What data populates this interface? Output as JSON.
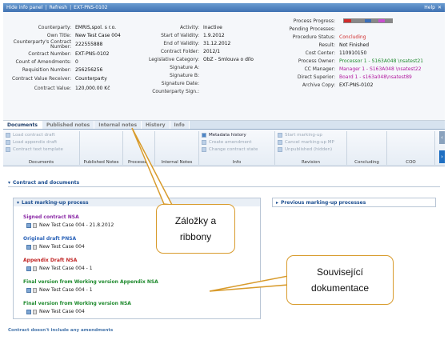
{
  "titlebar": {
    "hide": "Hide info panel",
    "refresh": "Refresh",
    "id": "EXT-PNS-0102",
    "help": "Help"
  },
  "col1": [
    {
      "label": "Counterparty:",
      "value": "EMRIS,spol. s r.o."
    },
    {
      "label": "Own Title:",
      "value": "New Test Case 004"
    },
    {
      "label": "Counterparty's Contract Number:",
      "value": "222555888"
    },
    {
      "label": "Contract Number:",
      "value": "EXT-PNS-0102"
    },
    {
      "label": "Count of Amendments:",
      "value": "0"
    },
    {
      "label": "Requisition Number:",
      "value": "256256256"
    },
    {
      "label": "Contract Value Receiver:",
      "value": "Counterparty"
    },
    {
      "label": "Contract Value:",
      "value": "120,000.00 Kč"
    }
  ],
  "col2": [
    {
      "label": "Activity:",
      "value": "Inactive"
    },
    {
      "label": "Start of Validity:",
      "value": "1.9.2012"
    },
    {
      "label": "End of Validity:",
      "value": "31.12.2012"
    },
    {
      "label": "Contract Folder:",
      "value": "2012/1"
    },
    {
      "label": "Legislative Category:",
      "value": "ObZ - Smlouva o dílo"
    },
    {
      "label": "Signature A:",
      "value": ""
    },
    {
      "label": "Signature B:",
      "value": ""
    },
    {
      "label": "Signature Date:",
      "value": ""
    },
    {
      "label": "Counterparty Sign.:",
      "value": ""
    }
  ],
  "col3": [
    {
      "label": "Process Progress:",
      "value": ""
    },
    {
      "label": "Pending Processes:",
      "value": ""
    },
    {
      "label": "Procedure Status:",
      "value": "Concluding",
      "color": "#d12b2b"
    },
    {
      "label": "Result:",
      "value": "Not Finished"
    },
    {
      "label": "Cost Center:",
      "value": "110910150"
    },
    {
      "label": "Process Owner:",
      "value": "Processor 1 - S163A048 \\nsatest21",
      "color": "#1f8a2e"
    },
    {
      "label": "CC Manager:",
      "value": "Manager 1 - S163A048 \\nsatest22",
      "color": "#b0169e"
    },
    {
      "label": "Direct Superior:",
      "value": "Board 1 - s163a048\\nsatest89",
      "color": "#b0169e"
    },
    {
      "label": "Archive Copy:",
      "value": "EXT-PNS-0102"
    }
  ],
  "progress_colors": [
    "#d12b2b",
    "#888",
    "#888",
    "#3b6fb8",
    "#888",
    "#c94fd0",
    "#888"
  ],
  "tabs": [
    "Documents",
    "Published notes",
    "Internal notes",
    "History",
    "Info"
  ],
  "ribbon": {
    "groups": [
      {
        "label": "Documents",
        "items": [
          "Load contract draft",
          "Load appendix draft",
          "Contract text template"
        ],
        "on": [
          false,
          false,
          false
        ]
      },
      {
        "label": "Published Notes",
        "items": [],
        "on": []
      },
      {
        "label": "Processes",
        "items": [],
        "on": []
      },
      {
        "label": "Internal Notes",
        "items": [],
        "on": []
      },
      {
        "label": "Info",
        "items": [
          "Metadata history",
          "Create amendment",
          "Change contract state"
        ],
        "on": [
          true,
          false,
          false
        ]
      },
      {
        "label": "Revision",
        "items": [
          "Start marking-up",
          "Cancel marking-up MP",
          "Unpublished (hidden)"
        ],
        "on": [
          false,
          false,
          false
        ]
      },
      {
        "label": "Concluding",
        "items": [],
        "on": []
      },
      {
        "label": "COO",
        "items": [],
        "on": []
      }
    ]
  },
  "section": "Contract and documents",
  "last_box": "Last marking-up process",
  "prev_box": "Previous marking-up processes",
  "docs": [
    {
      "title": "Signed contract NSA",
      "color": "#8b2aa6",
      "line": "New Test Case 004 - 21.8.2012"
    },
    {
      "title": "Original draft PNSA",
      "color": "#2a62b8",
      "line": "New Test Case 004"
    },
    {
      "title": "Appendix Draft NSA",
      "color": "#c02626",
      "line": "New Test Case 004 - 1"
    },
    {
      "title": "Final version from Working version Appendix NSA",
      "color": "#1f8a2e",
      "line": "New Test Case 004 - 1"
    },
    {
      "title": "Final version from Working version NSA",
      "color": "#1f8a2e",
      "line": "New Test Case 004"
    }
  ],
  "callouts": {
    "tabs": "Záložky a ribbony",
    "docs": "Související dokumentace"
  },
  "footer": "Contract doesn't include any amendments"
}
